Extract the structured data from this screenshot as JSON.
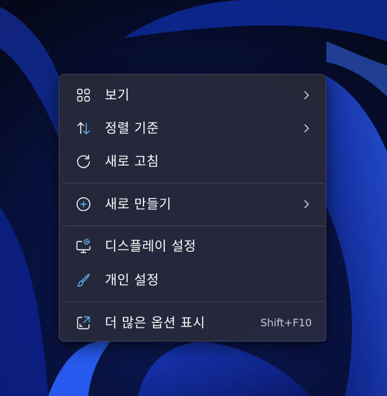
{
  "colors": {
    "menu_background": "#282a3a",
    "text": "#ffffff",
    "shortcut_text": "#c9c9d2",
    "icon_accent": "#5ab7f2",
    "separator": "#3c3e4f"
  },
  "context_menu": {
    "items": [
      {
        "label": "보기",
        "icon": "grid-view-icon",
        "has_submenu": true
      },
      {
        "label": "정렬 기준",
        "icon": "sort-arrows-icon",
        "has_submenu": true
      },
      {
        "label": "새로 고침",
        "icon": "refresh-icon",
        "has_submenu": false
      },
      {
        "label": "새로 만들기",
        "icon": "plus-circle-icon",
        "has_submenu": true
      },
      {
        "label": "디스플레이 설정",
        "icon": "display-settings-icon",
        "has_submenu": false
      },
      {
        "label": "개인 설정",
        "icon": "brush-icon",
        "has_submenu": false
      },
      {
        "label": "더 많은 옵션 표시",
        "icon": "open-external-icon",
        "has_submenu": false,
        "shortcut": "Shift+F10"
      }
    ]
  }
}
